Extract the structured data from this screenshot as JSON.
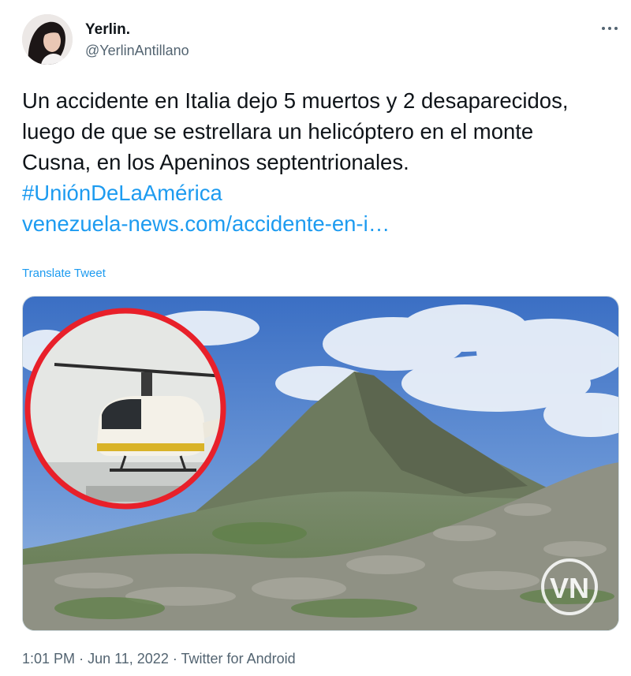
{
  "tweet": {
    "user": {
      "name": "Yerlin.",
      "handle": "@YerlinAntillano"
    },
    "more_icon": "more-horizontal-icon",
    "text": "Un accidente en Italia dejo 5 muertos y 2 desaparecidos, luego de que se estrellara un helicóptero en el monte Cusna, en los Apeninos septentrionales.",
    "hashtag": "#UniónDeLaAmérica",
    "link": "venezuela-news.com/accidente-en-i…",
    "translate_label": "Translate Tweet",
    "media": {
      "logo_text": "VN"
    },
    "meta": {
      "time": "1:01 PM",
      "separator_1": "·",
      "date": "Jun 11, 2022",
      "separator_2": "·",
      "source": "Twitter for Android"
    }
  },
  "colors": {
    "link": "#1d9bf0",
    "secondary_text": "#536471",
    "primary_text": "#0f1419",
    "circle_red": "#e8202a"
  }
}
